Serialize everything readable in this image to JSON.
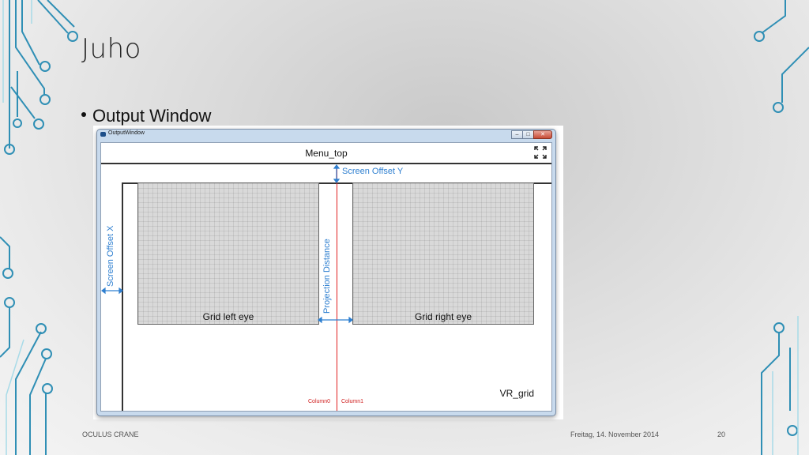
{
  "slide": {
    "title": "Juho",
    "bullet": "Output Window"
  },
  "window": {
    "title": "OutputWindow",
    "controls": {
      "minimize": "–",
      "maximize": "□",
      "close": "✕"
    },
    "menu_label": "Menu_top",
    "grid_left_label": "Grid left eye",
    "grid_right_label": "Grid right eye",
    "vr_label": "VR_grid",
    "column0": "Column0",
    "column1": "Column1"
  },
  "annotations": {
    "offset_y": "Screen Offset Y",
    "offset_x": "Screen Offset X",
    "projection": "Projection Distance"
  },
  "footer": {
    "left": "OCULUS CRANE",
    "date": "Freitag, 14. November 2014",
    "page": "20"
  },
  "colors": {
    "annotation": "#2e7fd0",
    "center_line": "#e02020",
    "circuit": "#2f8fb5"
  },
  "icons": {
    "expand": "expand-icon",
    "window": "window-app-icon",
    "decoration": "circuit-decoration"
  }
}
